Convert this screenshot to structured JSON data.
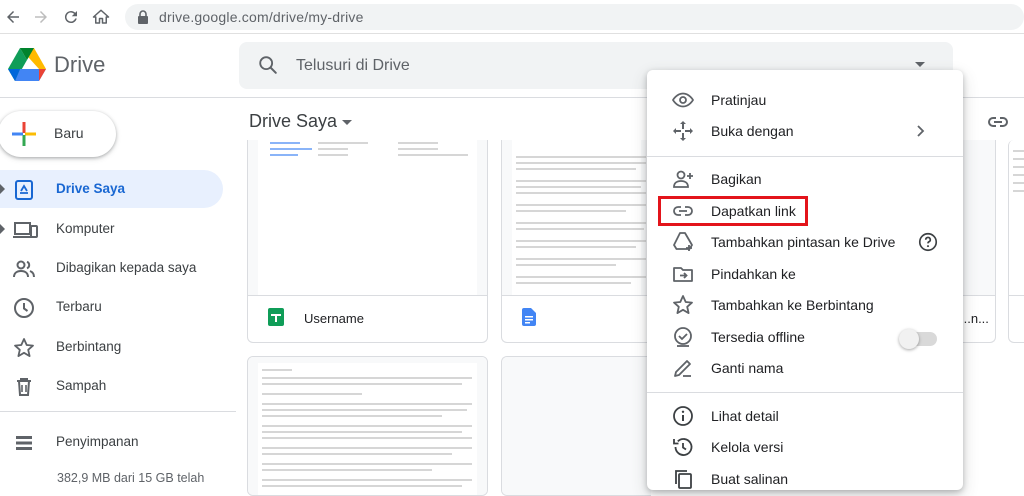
{
  "browser": {
    "url": "drive.google.com/drive/my-drive"
  },
  "header": {
    "app_name": "Drive",
    "search_placeholder": "Telusuri di Drive"
  },
  "sidebar": {
    "new_label": "Baru",
    "items": [
      {
        "label": "Drive Saya",
        "icon": "my-drive-icon",
        "active": true,
        "expandable": true
      },
      {
        "label": "Komputer",
        "icon": "computer-icon",
        "active": false,
        "expandable": true
      },
      {
        "label": "Dibagikan kepada saya",
        "icon": "shared-people-icon",
        "active": false,
        "expandable": false
      },
      {
        "label": "Terbaru",
        "icon": "clock-icon",
        "active": false,
        "expandable": false
      },
      {
        "label": "Berbintang",
        "icon": "star-icon",
        "active": false,
        "expandable": false
      },
      {
        "label": "Sampah",
        "icon": "trash-icon",
        "active": false,
        "expandable": false
      }
    ],
    "storage_label": "Penyimpanan",
    "storage_usage": "382,9 MB dari 15 GB telah"
  },
  "main": {
    "title": "Drive Saya",
    "files": [
      {
        "name": "Username",
        "type": "sheets-icon"
      },
      {
        "name": "",
        "type": "docs-icon"
      },
      {
        "name": "...n...",
        "type": "doc-icon"
      }
    ]
  },
  "context_menu": {
    "items": [
      {
        "label": "Pratinjau",
        "icon": "eye-icon"
      },
      {
        "label": "Buka dengan",
        "icon": "open-with-icon"
      },
      {
        "label": "Bagikan",
        "icon": "person-add-icon"
      },
      {
        "label": "Dapatkan link",
        "icon": "link-icon"
      },
      {
        "label": "Tambahkan pintasan ke Drive",
        "icon": "add-shortcut-icon"
      },
      {
        "label": "Pindahkan ke",
        "icon": "move-to-icon"
      },
      {
        "label": "Tambahkan ke Berbintang",
        "icon": "star-outline-icon"
      },
      {
        "label": "Tersedia offline",
        "icon": "offline-check-icon"
      },
      {
        "label": "Ganti nama",
        "icon": "pencil-icon"
      },
      {
        "label": "Lihat detail",
        "icon": "info-icon"
      },
      {
        "label": "Kelola versi",
        "icon": "history-icon"
      },
      {
        "label": "Buat salinan",
        "icon": "copy-icon"
      }
    ],
    "offline_enabled": false
  },
  "colors": {
    "accent_blue": "#1967d2",
    "active_bg": "#e8f0fe",
    "highlight_red": "#e3141b"
  }
}
